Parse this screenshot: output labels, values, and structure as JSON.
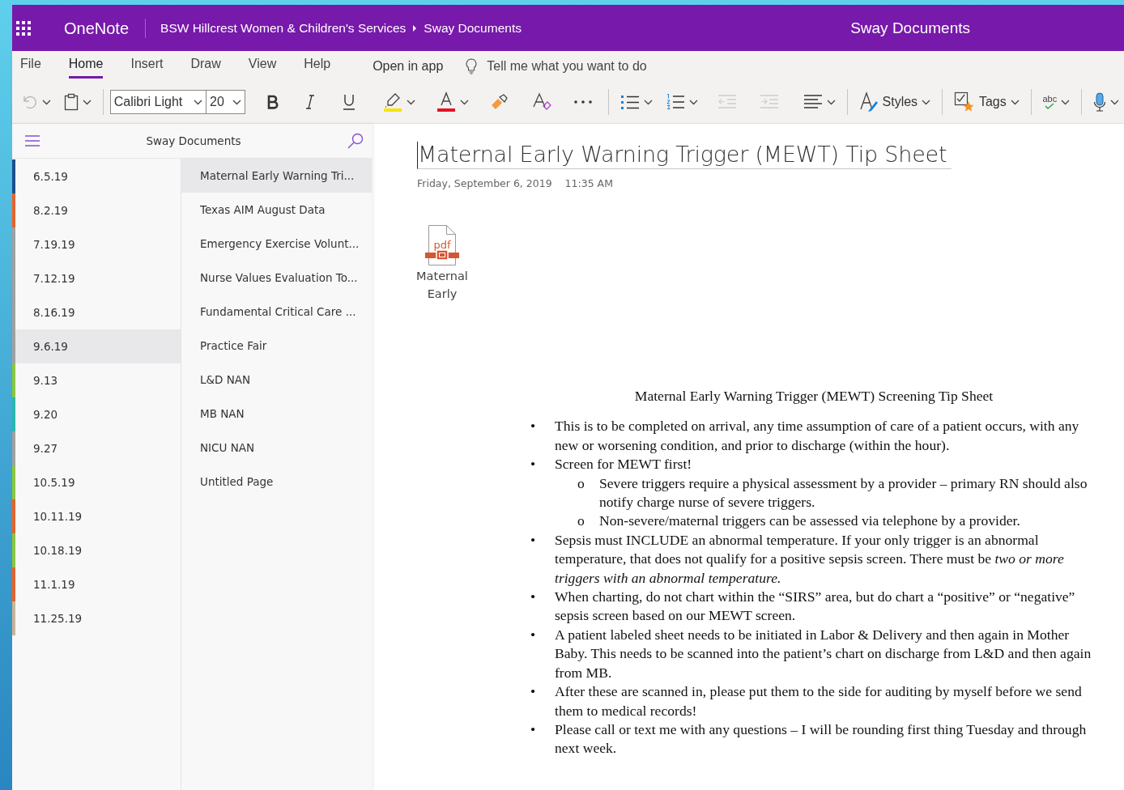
{
  "app_bar": {
    "app_name": "OneNote",
    "breadcrumb": [
      "BSW Hillcrest Women & Children's Services",
      "Sway Documents"
    ],
    "notebook_title": "Sway Documents"
  },
  "tabs": [
    {
      "label": "File",
      "selected": false
    },
    {
      "label": "Home",
      "selected": true
    },
    {
      "label": "Insert",
      "selected": false
    },
    {
      "label": "Draw",
      "selected": false
    },
    {
      "label": "View",
      "selected": false
    },
    {
      "label": "Help",
      "selected": false
    }
  ],
  "open_in_app": "Open in app",
  "tell_me": {
    "placeholder": "Tell me what you want to do"
  },
  "toolbar": {
    "undo": {
      "disabled": true
    },
    "font_name": "Calibri Light",
    "font_size": "20",
    "decrease_indent": {
      "disabled": true
    },
    "increase_indent": {
      "disabled": true
    },
    "styles": "Styles",
    "tags": "Tags",
    "spelling_icon_text": "abc"
  },
  "navigation": {
    "title": "Sway Documents"
  },
  "sections": [
    {
      "name": "6.5.19",
      "color": "#1b4f8a",
      "selected": false
    },
    {
      "name": "8.2.19",
      "color": "#e8632b",
      "selected": false
    },
    {
      "name": "7.19.19",
      "color": "#a0a0a0",
      "selected": false
    },
    {
      "name": "7.12.19",
      "color": "#a0a0a0",
      "selected": false
    },
    {
      "name": "8.16.19",
      "color": "#a0a0a0",
      "selected": false
    },
    {
      "name": "9.6.19",
      "color": "#a0a0a0",
      "selected": true
    },
    {
      "name": "9.13",
      "color": "#8cc63f",
      "selected": false
    },
    {
      "name": "9.20",
      "color": "#2bb6b0",
      "selected": false
    },
    {
      "name": "9.27",
      "color": "#a0a0a0",
      "selected": false
    },
    {
      "name": "10.5.19",
      "color": "#8cc63f",
      "selected": false
    },
    {
      "name": "10.11.19",
      "color": "#e8632b",
      "selected": false
    },
    {
      "name": "10.18.19",
      "color": "#8cc63f",
      "selected": false
    },
    {
      "name": "11.1.19",
      "color": "#e8632b",
      "selected": false
    },
    {
      "name": "11.25.19",
      "color": "#c8b49a",
      "selected": false
    }
  ],
  "pages": [
    {
      "title": "Maternal Early Warning Tri...",
      "selected": true
    },
    {
      "title": "Texas AIM August Data",
      "selected": false
    },
    {
      "title": "Emergency Exercise Volunt...",
      "selected": false
    },
    {
      "title": "Nurse Values Evaluation To...",
      "selected": false
    },
    {
      "title": "Fundamental Critical Care ...",
      "selected": false
    },
    {
      "title": "Practice Fair",
      "selected": false
    },
    {
      "title": "L&D NAN",
      "selected": false
    },
    {
      "title": "MB NAN",
      "selected": false
    },
    {
      "title": "NICU NAN",
      "selected": false
    },
    {
      "title": "Untitled Page",
      "selected": false
    }
  ],
  "note": {
    "title": "Maternal Early Warning Trigger (MEWT) Tip Sheet",
    "date": "Friday, September 6, 2019",
    "time": "11:35 AM",
    "attachment": {
      "icon_text": "pdf",
      "name": "Maternal Early"
    },
    "heading": "Maternal Early Warning Trigger (MEWT) Screening Tip Sheet",
    "items": [
      {
        "marker": "•",
        "text": "This is to be completed on arrival, any time assumption of care of a patient occurs, with any new or worsening condition, and prior to discharge (within the hour)."
      },
      {
        "marker": "•",
        "text": "Screen for MEWT first!",
        "children": [
          {
            "marker": "o",
            "text": "Severe triggers require a physical assessment by a provider – primary RN should also notify charge nurse of severe triggers."
          },
          {
            "marker": "o",
            "text": "Non-severe/maternal triggers can be assessed via telephone by a provider."
          }
        ]
      },
      {
        "marker": "•",
        "text": "Sepsis must INCLUDE an abnormal temperature.  If your only trigger is an abnormal temperature, that does not qualify for a positive sepsis screen.  There must be *two or more triggers with an abnormal temperature.*"
      },
      {
        "marker": "•",
        "text": "When charting, do not chart within the “SIRS” area, but do chart a “positive” or “negative” sepsis screen based on our MEWT screen."
      },
      {
        "marker": "•",
        "text": "A patient labeled sheet needs to be initiated in Labor & Delivery and then again in Mother Baby.  This needs to be scanned into the patient’s chart on discharge from L&D and then again from MB."
      },
      {
        "marker": "•",
        "text": "After these are scanned in, please put them to the side for auditing by myself before we send them to medical records!"
      },
      {
        "marker": "•",
        "text": "Please call or text me with any questions – I will be rounding first thing Tuesday and through next week."
      }
    ]
  }
}
